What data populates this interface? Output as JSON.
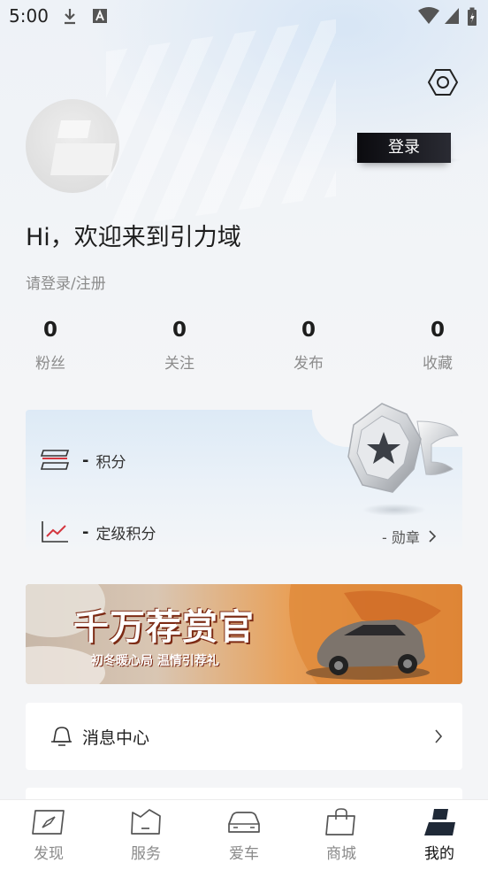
{
  "status_bar": {
    "time": "5:00"
  },
  "header": {
    "login_button": "登录",
    "welcome": "Hi，欢迎来到引力域",
    "login_hint": "请登录/注册"
  },
  "stats": [
    {
      "value": "0",
      "label": "粉丝"
    },
    {
      "value": "0",
      "label": "关注"
    },
    {
      "value": "0",
      "label": "发布"
    },
    {
      "value": "0",
      "label": "收藏"
    }
  ],
  "points_card": {
    "points_value": "-",
    "points_label": "积分",
    "level_value": "-",
    "level_label": "定级积分",
    "medal_link": "- 勋章"
  },
  "banner": {
    "title": "千万荐赏官",
    "subtitle": "初冬暖心局 温情引荐礼"
  },
  "menu": {
    "message_center": "消息中心"
  },
  "tabs": [
    {
      "label": "发现",
      "icon": "compass-icon"
    },
    {
      "label": "服务",
      "icon": "service-icon"
    },
    {
      "label": "爱车",
      "icon": "car-icon"
    },
    {
      "label": "商城",
      "icon": "shopping-bag-icon"
    },
    {
      "label": "我的",
      "icon": "profile-icon",
      "active": true
    }
  ]
}
